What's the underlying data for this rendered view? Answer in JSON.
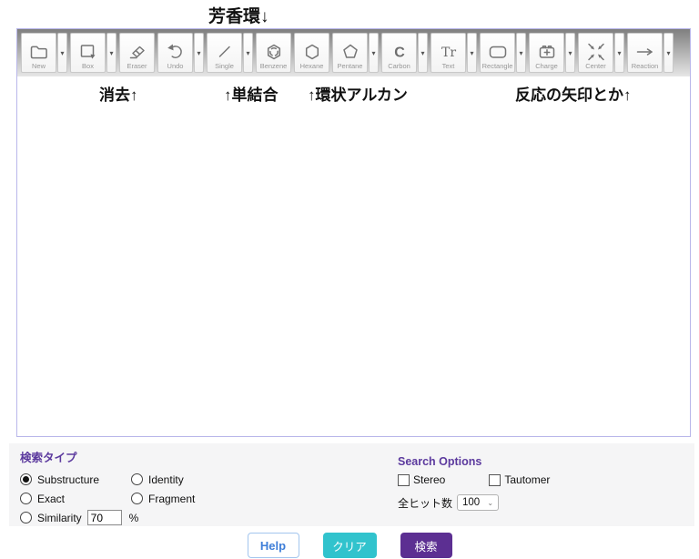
{
  "annotations": {
    "top_aromatic_ring": "芳香環↓",
    "eraser_note": "消去↑",
    "single_bond_note": "↑単結合",
    "cyclic_alkane_note": "↑環状アルカン",
    "reaction_arrow_note": "反応の矢印とか↑"
  },
  "toolbar": {
    "buttons": [
      {
        "label": "New",
        "icon": "new-document-icon",
        "has_menu": true
      },
      {
        "label": "Box",
        "icon": "box-select-icon",
        "has_menu": true
      },
      {
        "label": "Eraser",
        "icon": "eraser-icon",
        "has_menu": false
      },
      {
        "label": "Undo",
        "icon": "undo-icon",
        "has_menu": true
      },
      {
        "label": "Single",
        "icon": "single-bond-icon",
        "has_menu": true
      },
      {
        "label": "Benzene",
        "icon": "benzene-ring-icon",
        "has_menu": false
      },
      {
        "label": "Hexane",
        "icon": "hexane-ring-icon",
        "has_menu": false
      },
      {
        "label": "Pentane",
        "icon": "pentane-ring-icon",
        "has_menu": true
      },
      {
        "label": "Carbon",
        "icon": "carbon-atom-icon",
        "has_menu": true
      },
      {
        "label": "Text",
        "icon": "text-icon",
        "has_menu": true
      },
      {
        "label": "Rectangle",
        "icon": "rectangle-icon",
        "has_menu": true
      },
      {
        "label": "Charge",
        "icon": "charge-icon",
        "has_menu": true
      },
      {
        "label": "Center",
        "icon": "center-arrows-icon",
        "has_menu": true
      },
      {
        "label": "Reaction",
        "icon": "reaction-arrow-icon",
        "has_menu": true
      }
    ]
  },
  "search_type": {
    "heading": "検索タイプ",
    "options": [
      {
        "label": "Substructure",
        "selected": true
      },
      {
        "label": "Identity",
        "selected": false
      },
      {
        "label": "Exact",
        "selected": false
      },
      {
        "label": "Fragment",
        "selected": false
      },
      {
        "label": "Similarity",
        "selected": false,
        "input_value": "70",
        "suffix": "%"
      }
    ]
  },
  "search_options": {
    "heading": "Search Options",
    "checkboxes": [
      {
        "label": "Stereo",
        "checked": false
      },
      {
        "label": "Tautomer",
        "checked": false
      }
    ],
    "max_hits_label": "全ヒット数",
    "max_hits_value": "100"
  },
  "footer": {
    "help_label": "Help",
    "clear_label": "クリア",
    "search_label": "検索"
  },
  "colors": {
    "heading_purple": "#5c3a9e",
    "clear_button_teal": "#31c3cd",
    "search_button_purple": "#5c2f92",
    "help_button_blue": "#3e7ed8",
    "editor_border": "#b9b7ea",
    "panel_gray": "#f5f5f6"
  }
}
